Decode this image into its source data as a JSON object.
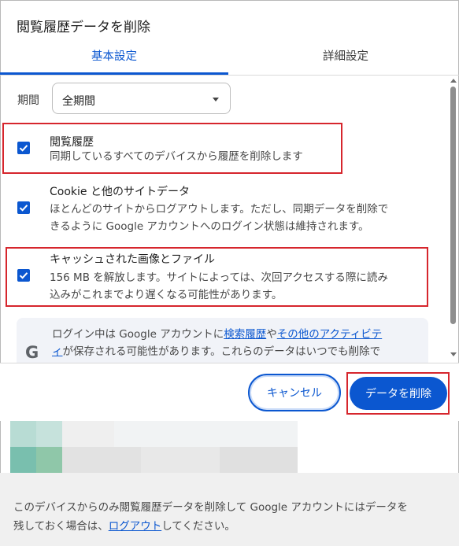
{
  "dialog": {
    "title": "閲覧履歴データを削除",
    "tabs": [
      {
        "label": "基本設定",
        "active": true
      },
      {
        "label": "詳細設定",
        "active": false
      }
    ]
  },
  "period": {
    "label": "期間",
    "selected": "全期間"
  },
  "items": [
    {
      "title": "閲覧履歴",
      "desc": [
        "同期しているすべてのデバイスから履歴を削除します"
      ],
      "checked": true,
      "highlighted": true
    },
    {
      "title": "Cookie と他のサイトデータ",
      "desc": [
        "ほとんどのサイトからログアウトします。ただし、同期データを削除で",
        "きるように Google アカウントへのログイン状態は維持されます。"
      ],
      "checked": true,
      "highlighted": false
    },
    {
      "title": "キャッシュされた画像とファイル",
      "desc": [
        "156 MB を解放します。サイトによっては、次回アクセスする際に読み",
        "込みがこれまでより遅くなる可能性があります。"
      ],
      "checked": true,
      "highlighted": true
    }
  ],
  "info": {
    "icon": "google-g-icon",
    "text1": "ログイン中は Google アカウントに",
    "link1": "検索履歴",
    "text2": "や",
    "link2": "その他のアクティビテ",
    "link2b": "ィ",
    "text3": "が保存される可能性があります。これらのデータはいつでも削除で"
  },
  "buttons": {
    "cancel": "キャンセル",
    "delete": "データを削除"
  },
  "bottom": {
    "text1": "このデバイスからのみ閲覧履歴データを削除して Google アカウントにはデータを",
    "text2": "残しておく場合は、",
    "link": "ログアウト",
    "text3": "してください。"
  },
  "colors": {
    "accent": "#0b57d0",
    "highlight": "#d6262d"
  }
}
